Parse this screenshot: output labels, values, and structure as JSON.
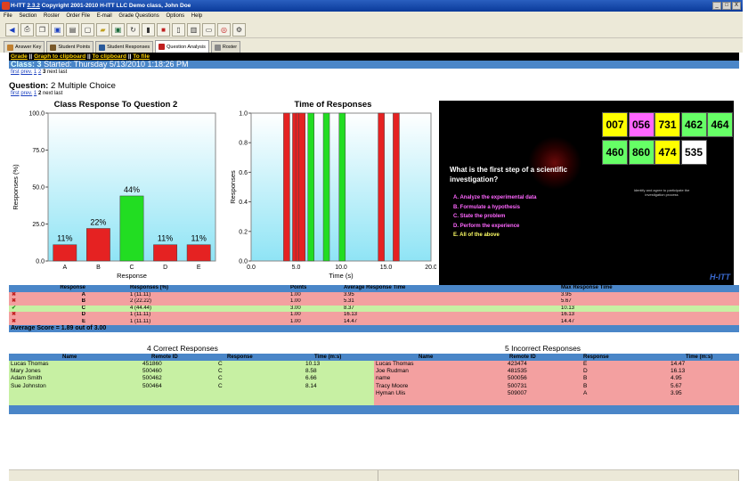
{
  "window": {
    "title_pre": "H-ITT ",
    "title_ver": "2.3.2",
    "title_post": " Copyright 2001-2010 H-ITT LLC Demo class, John Doe",
    "min": "_",
    "max": "□",
    "close": "X"
  },
  "menu": [
    "File",
    "Section",
    "Roster",
    "Order File",
    "E-mail",
    "Grade Questions",
    "Options",
    "Help"
  ],
  "tabs": [
    {
      "label": "Answer Key",
      "color": "#c08030"
    },
    {
      "label": "Student Points",
      "color": "#7a5a2a"
    },
    {
      "label": "Student Responses",
      "color": "#2a5a9a"
    },
    {
      "label": "Question Analysis",
      "color": "#c02020"
    },
    {
      "label": "Roster",
      "color": "#888888"
    }
  ],
  "links": {
    "grade": "Grade",
    "sep": "||",
    "graph_clip": "Graph to clipboard",
    "to_clip": "To clipboard",
    "to_file": "To file"
  },
  "class_line": {
    "label": "Class:",
    "num": "3",
    "started": "Started: Thursday 5/13/2010 1:18:26 PM"
  },
  "nav1": {
    "first": "first",
    "prev": "prev.",
    "p1": "1",
    "p2": "2",
    "p3": "3",
    "next": "next",
    "last": "last"
  },
  "question_line": {
    "label": "Question:",
    "num": "2",
    "type": "Multiple Choice"
  },
  "nav2": {
    "first": "first",
    "prev": "prev.",
    "p1": "1",
    "p2": "2",
    "next": "next",
    "last": "last"
  },
  "chart_data": [
    {
      "type": "bar",
      "title": "Class Response To Question 2",
      "xlabel": "Response",
      "ylabel": "Responses (%)",
      "categories": [
        "A",
        "B",
        "C",
        "D",
        "E"
      ],
      "values": [
        11,
        22,
        44,
        11,
        11
      ],
      "labels": [
        "11%",
        "22%",
        "44%",
        "11%",
        "11%"
      ],
      "colors": [
        "#e52222",
        "#e52222",
        "#22dd22",
        "#e52222",
        "#e52222"
      ],
      "ylim": [
        0,
        100
      ],
      "yticks": [
        "0.0",
        "25.0",
        "50.0",
        "75.0",
        "100.0"
      ]
    },
    {
      "type": "bar",
      "title": "Time of Responses",
      "xlabel": "Time (s)",
      "ylabel": "Responses",
      "xlim": [
        0,
        20
      ],
      "ylim": [
        0,
        1
      ],
      "xticks": [
        "0.0",
        "5.0",
        "10.0",
        "15.0",
        "20.0"
      ],
      "yticks": [
        "0.0",
        "0.2",
        "0.4",
        "0.6",
        "0.8",
        "1.0"
      ],
      "bars": [
        {
          "x": 3.95,
          "color": "#e52222"
        },
        {
          "x": 4.95,
          "color": "#e52222"
        },
        {
          "x": 5.31,
          "color": "#e52222"
        },
        {
          "x": 5.67,
          "color": "#e52222"
        },
        {
          "x": 6.66,
          "color": "#22dd22"
        },
        {
          "x": 8.37,
          "color": "#22dd22"
        },
        {
          "x": 10.13,
          "color": "#22dd22"
        },
        {
          "x": 14.47,
          "color": "#e52222"
        },
        {
          "x": 16.13,
          "color": "#e52222"
        }
      ]
    }
  ],
  "slide": {
    "question": "What is the first step of a scientific investigation?",
    "options": [
      "A. Analyze the experimental data",
      "B. Formulate a hypothesis",
      "C. State the problem",
      "D. Perform the experience",
      "E. All of the above"
    ],
    "small_text": "Identify and agree to participate the investigation process",
    "numbers": [
      {
        "v": "007",
        "c": "#ffff00"
      },
      {
        "v": "056",
        "c": "#ff66ff"
      },
      {
        "v": "731",
        "c": "#ffff00"
      },
      {
        "v": "462",
        "c": "#66ff66"
      },
      {
        "v": "464",
        "c": "#66ff66"
      },
      {
        "v": "460",
        "c": "#66ff66"
      },
      {
        "v": "860",
        "c": "#66ff66"
      },
      {
        "v": "474",
        "c": "#ffff00"
      },
      {
        "v": "535",
        "c": "#ffffff"
      }
    ]
  },
  "resp_table": {
    "headers": [
      "Response",
      "Responses (%)",
      "Points",
      "Average Response Time",
      "Max Response Time"
    ],
    "rows": [
      {
        "mark": "✖",
        "resp": "A",
        "pct": "1 (11.11)",
        "pts": "1.00",
        "avg": "3.95",
        "max": "3.95",
        "ok": false
      },
      {
        "mark": "✖",
        "resp": "B",
        "pct": "2 (22.22)",
        "pts": "1.00",
        "avg": "5.31",
        "max": "5.67",
        "ok": false
      },
      {
        "mark": "✔",
        "resp": "C",
        "pct": "4 (44.44)",
        "pts": "3.00",
        "avg": "8.37",
        "max": "10.13",
        "ok": true
      },
      {
        "mark": "✖",
        "resp": "D",
        "pct": "1 (11.11)",
        "pts": "1.00",
        "avg": "16.13",
        "max": "16.13",
        "ok": false
      },
      {
        "mark": "✖",
        "resp": "E",
        "pct": "1 (11.11)",
        "pts": "1.00",
        "avg": "14.47",
        "max": "14.47",
        "ok": false
      }
    ],
    "avg_score": "Average Score = 1.89 out of 3.00"
  },
  "correct": {
    "title": "4 Correct Responses",
    "headers": [
      "Name",
      "Remote ID",
      "Response",
      "Time (m:s)"
    ],
    "rows": [
      [
        "Lucas Thomas",
        "451860",
        "C",
        "10.13"
      ],
      [
        "Mary Jones",
        "500460",
        "C",
        "8.58"
      ],
      [
        "Adam Smith",
        "500462",
        "C",
        "6.66"
      ],
      [
        "Sue Johnston",
        "500464",
        "C",
        "8.14"
      ]
    ]
  },
  "incorrect": {
    "title": "5 Incorrect Responses",
    "headers": [
      "Name",
      "Remote ID",
      "Response",
      "Time (m:s)"
    ],
    "rows": [
      [
        "Lucas Thomas",
        "423474",
        "E",
        "14.47"
      ],
      [
        "Joe Rudman",
        "481535",
        "D",
        "16.13"
      ],
      [
        "name",
        "500056",
        "B",
        "4.95"
      ],
      [
        "Tracy Moore",
        "500731",
        "B",
        "5.67"
      ],
      [
        "Hyman Ulis",
        "509007",
        "A",
        "3.95"
      ]
    ]
  }
}
